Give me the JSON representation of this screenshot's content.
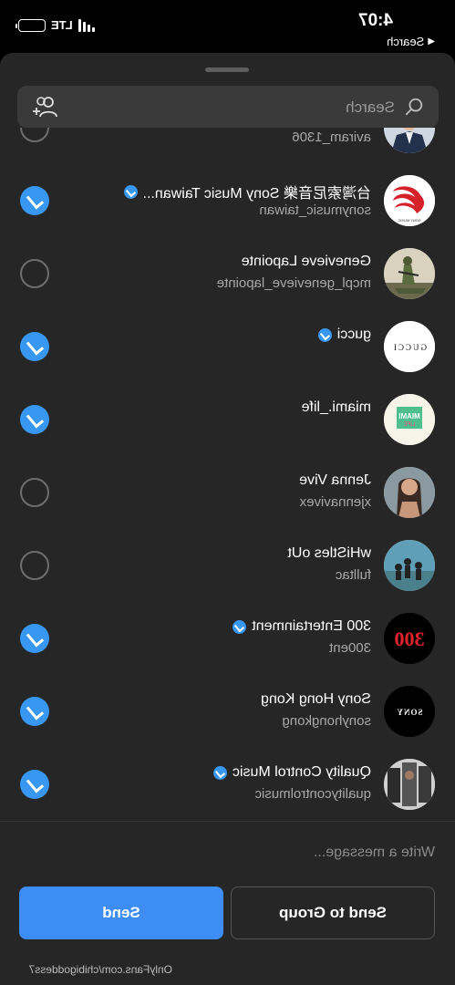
{
  "status_bar": {
    "time": "4:07",
    "back_label": "Search",
    "network": "LTE"
  },
  "sheet": {
    "search": {
      "placeholder": "Search"
    }
  },
  "contacts": [
    {
      "name": "",
      "handle": "aviram_1306",
      "verified": false,
      "selected": false,
      "avatar_icon": "suit-portrait"
    },
    {
      "name": "台灣索尼音樂 Sony Music Taiwan...",
      "handle": "sonymusic_taiwan",
      "verified": true,
      "selected": true,
      "avatar_icon": "sony-music-logo"
    },
    {
      "name": "Genevieve Lapointe",
      "handle": "mcpl_genevieve_lapointe",
      "verified": false,
      "selected": false,
      "avatar_icon": "soldier-photo"
    },
    {
      "name": "gucci",
      "handle": "",
      "verified": true,
      "selected": true,
      "avatar_icon": "gucci-logo"
    },
    {
      "name": "miami._life",
      "handle": "",
      "verified": false,
      "selected": true,
      "avatar_icon": "miami-life-logo"
    },
    {
      "name": "Jenna Vive",
      "handle": "xjennavivex",
      "verified": false,
      "selected": false,
      "avatar_icon": "portrait-photo"
    },
    {
      "name": "wHiStles oUt",
      "handle": "fulltac",
      "verified": false,
      "selected": false,
      "avatar_icon": "team-photo"
    },
    {
      "name": "300 Entertainment",
      "handle": "300ent",
      "verified": true,
      "selected": true,
      "avatar_icon": "300-logo"
    },
    {
      "name": "Sony Hong Kong",
      "handle": "sonyhongkong",
      "verified": false,
      "selected": true,
      "avatar_icon": "sony-logo"
    },
    {
      "name": "Quality Control Music",
      "handle": "qualitycontrolmusic",
      "verified": true,
      "selected": true,
      "avatar_icon": "qc-photo"
    }
  ],
  "avatar_text": {
    "sony_music": "SONY MUSIC",
    "gucci": "GUCCI",
    "miami": "MIAMI",
    "life": "LIFE",
    "e300": "300",
    "sony": "SONY"
  },
  "composer": {
    "placeholder": "Write a message..."
  },
  "buttons": {
    "send_to_group": "Send to Group",
    "send": "Send"
  },
  "watermark": "OnlyFans.com/chibigoddess7",
  "colors": {
    "accent": "#3897f0",
    "send_button": "#3d8df5",
    "sheet": "#262626"
  }
}
